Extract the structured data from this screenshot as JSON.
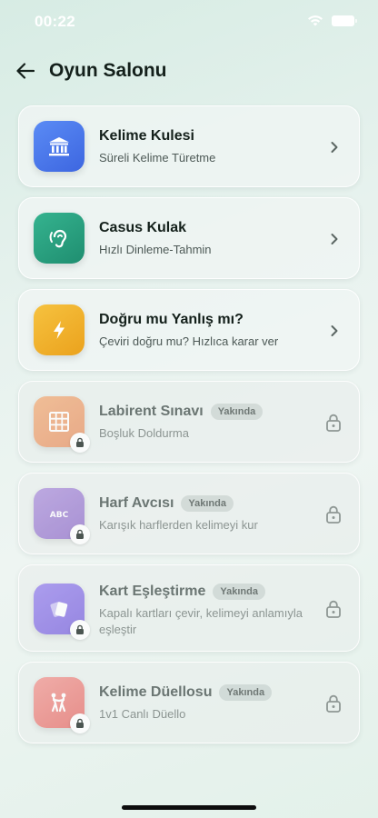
{
  "status": {
    "time": "00:22"
  },
  "header": {
    "title": "Oyun Salonu"
  },
  "games": [
    {
      "name": "Kelime Kulesi",
      "desc": "Süreli Kelime Türetme",
      "icon": "bank-icon",
      "color": "#4f7df0",
      "locked": false
    },
    {
      "name": "Casus Kulak",
      "desc": "Hızlı Dinleme-Tahmin",
      "icon": "ear-icon",
      "color": "#2aa382",
      "locked": false
    },
    {
      "name": "Doğru mu Yanlış mı?",
      "desc": "Çeviri doğru mu? Hızlıca karar ver",
      "icon": "lightning-icon",
      "color": "#f2b329",
      "locked": false
    },
    {
      "name": "Labirent Sınavı",
      "badge": "Yakında",
      "desc": "Boşluk Doldurma",
      "icon": "grid-icon",
      "color": "#eda577",
      "locked": true
    },
    {
      "name": "Harf Avcısı",
      "badge": "Yakında",
      "desc": "Karışık harflerden kelimeyi kur",
      "icon": "abc-icon",
      "color": "#a88ad6",
      "locked": true
    },
    {
      "name": "Kart Eşleştirme",
      "badge": "Yakında",
      "desc": "Kapalı kartları çevir, kelimeyi anlamıyla eşleştir",
      "icon": "cards-icon",
      "color": "#8f7be8",
      "locked": true
    },
    {
      "name": "Kelime Düellosu",
      "badge": "Yakında",
      "desc": "1v1 Canlı Düello",
      "icon": "duel-icon",
      "color": "#ee8a86",
      "locked": true
    }
  ],
  "icon_labels": {
    "abc": "ABC"
  }
}
